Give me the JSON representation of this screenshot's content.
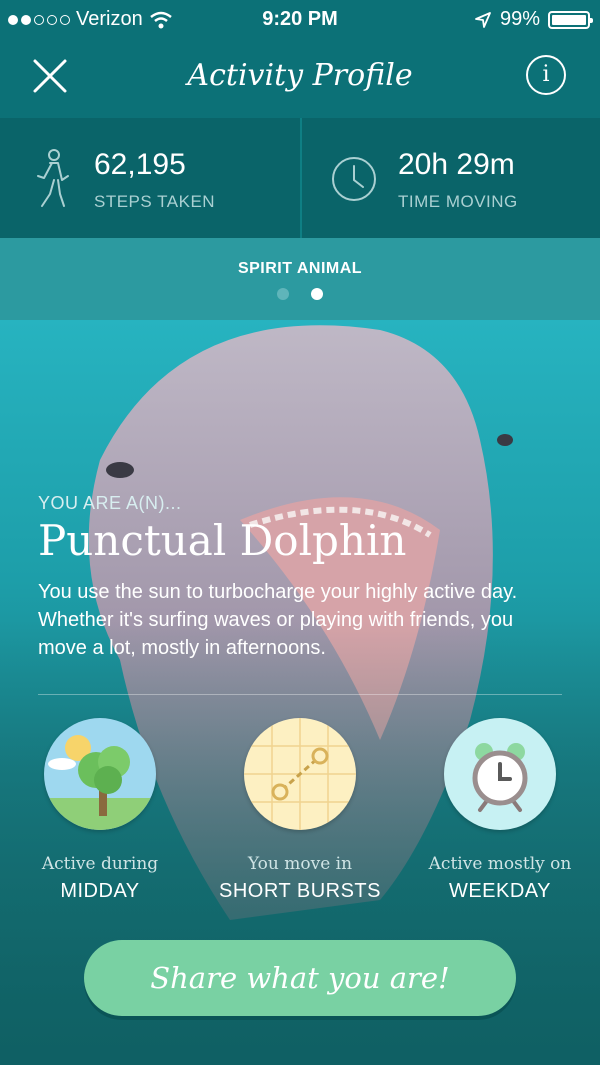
{
  "status": {
    "carrier": "Verizon",
    "time": "9:20 PM",
    "battery": "99%",
    "battery_level": 0.99,
    "signal_bars_filled": 2,
    "signal_bars_total": 5
  },
  "nav": {
    "title": "Activity Profile",
    "close_icon": "close-icon",
    "info_icon": "info-icon",
    "info_glyph": "i"
  },
  "stats": {
    "steps": {
      "value": "62,195",
      "label": "STEPS TAKEN",
      "icon": "walking-person-icon"
    },
    "time": {
      "value": "20h 29m",
      "label": "TIME MOVING",
      "icon": "clock-icon"
    }
  },
  "spirit": {
    "label": "SPIRIT ANIMAL",
    "page_index": 1,
    "page_count": 2
  },
  "profile": {
    "prefix": "YOU ARE A(N)...",
    "animal": "Punctual Dolphin",
    "description": "You use the sun to turbocharge your highly active day. Whether it's surfing waves or playing with friends, you move a lot, mostly in afternoons."
  },
  "badges": [
    {
      "caption": "Active during",
      "value": "MIDDAY",
      "icon": "tree-sun-icon"
    },
    {
      "caption": "You move in",
      "value": "SHORT BURSTS",
      "icon": "map-route-icon"
    },
    {
      "caption": "Active mostly on",
      "value": "WEEKDAY",
      "icon": "alarm-clock-icon"
    }
  ],
  "share_label": "Share what you are!",
  "colors": {
    "header": "#0c7177",
    "stats_bg": "#0a6469",
    "spirit_bg": "#2c9aa0",
    "share_button": "#79d1a3"
  }
}
